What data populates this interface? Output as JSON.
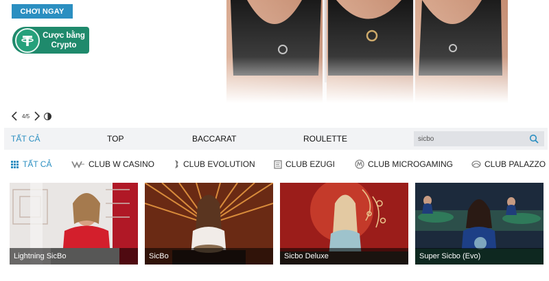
{
  "hero": {
    "play_label": "CHƠI NGAY",
    "crypto_line1": "Cược bằng",
    "crypto_line2": "Crypto",
    "pager_text": "4/5",
    "icons": {
      "prev": "chevron-left-icon",
      "next": "chevron-right-icon",
      "theme": "half-circle-icon",
      "coin": "tether-icon"
    }
  },
  "categories": {
    "items": [
      "TẤT CẢ",
      "TOP",
      "BACCARAT",
      "ROULETTE"
    ],
    "active_index": 0,
    "search_value": "sicbo",
    "search_icon": "search-icon"
  },
  "clubs": {
    "items": [
      "TẤT CẢ",
      "CLUB W CASINO",
      "CLUB EVOLUTION",
      "CLUB EZUGI",
      "CLUB MICROGAMING",
      "CLUB PALAZZO"
    ],
    "active_index": 0,
    "icons": [
      "grid-icon",
      "w-casino-logo-icon",
      "evolution-logo-icon",
      "ezugi-logo-icon",
      "microgaming-logo-icon",
      "palazzo-logo-icon"
    ]
  },
  "games": [
    {
      "title": "Lightning SicBo"
    },
    {
      "title": "SicBo"
    },
    {
      "title": "Sicbo Deluxe"
    },
    {
      "title": "Super Sicbo (Evo)"
    }
  ],
  "colors": {
    "accent": "#2b8fc1",
    "crypto": "#1f8a6c",
    "bar_bg": "#f2f3f5"
  }
}
